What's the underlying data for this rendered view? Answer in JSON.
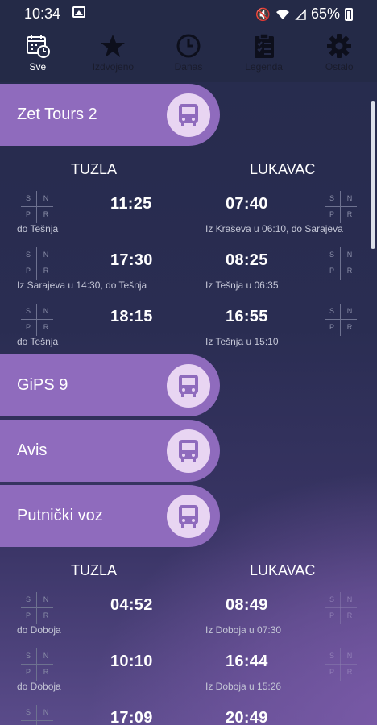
{
  "status": {
    "time": "10:34",
    "battery": "65%"
  },
  "tabs": [
    {
      "label": "Sve",
      "icon": "calendar-clock-icon",
      "active": true
    },
    {
      "label": "Izdvojeno",
      "icon": "star-icon"
    },
    {
      "label": "Danas",
      "icon": "clock-icon"
    },
    {
      "label": "Legenda",
      "icon": "clipboard-list-icon"
    },
    {
      "label": "Ostalo",
      "icon": "gear-icon"
    }
  ],
  "legend_letters": {
    "s": "S",
    "n": "N",
    "p": "P",
    "r": "R"
  },
  "operators": [
    {
      "name": "Zet Tours 2"
    },
    {
      "name": "GiPS 9"
    },
    {
      "name": "Avis"
    },
    {
      "name": "Putnički voz"
    }
  ],
  "group1": {
    "from": "TUZLA",
    "to": "LUKAVAC",
    "rows": [
      {
        "dep": "11:25",
        "dep_note": "do Tešnja",
        "ret": "07:40",
        "ret_note": "Iz Kraševa u 06:10, do Sarajeva"
      },
      {
        "dep": "17:30",
        "dep_note": "Iz Sarajeva u 14:30, do Tešnja",
        "ret": "08:25",
        "ret_note": "Iz Tešnja u 06:35"
      },
      {
        "dep": "18:15",
        "dep_note": "do Tešnja",
        "ret": "16:55",
        "ret_note": "Iz Tešnja u 15:10"
      }
    ]
  },
  "group2": {
    "from": "TUZLA",
    "to": "LUKAVAC",
    "rows": [
      {
        "dep": "04:52",
        "dep_note": "do Doboja",
        "ret": "08:49",
        "ret_note": "Iz Doboja u 07:30"
      },
      {
        "dep": "10:10",
        "dep_note": "do Doboja",
        "ret": "16:44",
        "ret_note": "Iz Doboja u 15:26"
      },
      {
        "dep": "17:09",
        "dep_note": "",
        "ret": "20:49",
        "ret_note": ""
      }
    ]
  }
}
